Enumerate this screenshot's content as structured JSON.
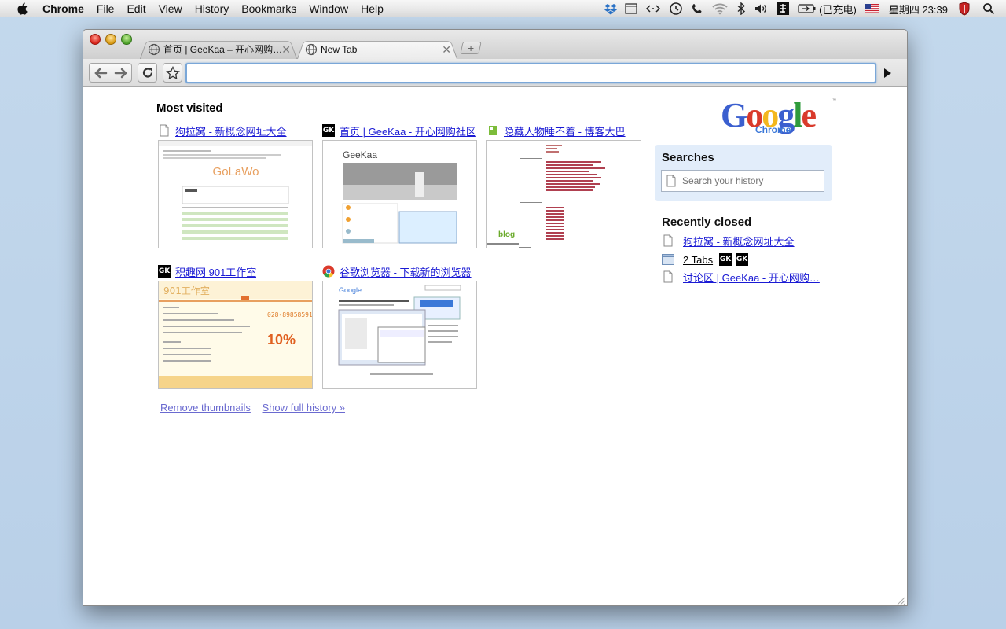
{
  "menubar": {
    "app_name": "Chrome",
    "items": [
      "File",
      "Edit",
      "View",
      "History",
      "Bookmarks",
      "Window",
      "Help"
    ],
    "battery_status": "(已充电)",
    "clock": "星期四 23:39"
  },
  "tabs": [
    {
      "title": "首页 | GeeKaa – 开心网购社区",
      "icon": "globe-icon",
      "active": false
    },
    {
      "title": "New Tab",
      "icon": "globe-icon",
      "active": true
    }
  ],
  "omnibox": {
    "value": ""
  },
  "most_visited": {
    "heading": "Most visited",
    "tiles": [
      {
        "title": "狗拉窝 - 新概念网址大全",
        "icon": "page-icon",
        "thumb_text": "GoLaWo"
      },
      {
        "title": "首页 | GeeKaa - 开心网购社区",
        "icon": "gk-icon",
        "thumb_text": "GeeKaa"
      },
      {
        "title": "隐藏人物睡不着 - 博客大巴",
        "icon": "blogbus-icon",
        "thumb_text": "blog"
      },
      {
        "title": "积趣网 901工作室",
        "icon": "gk-icon",
        "thumb_text": "901工作室",
        "thumb_phone": "028-89858591",
        "thumb_big": "10%"
      },
      {
        "title": "谷歌浏览器 - 下载新的浏览器",
        "icon": "chrome-icon",
        "thumb_text": "Google"
      }
    ],
    "remove_thumbnails": "Remove thumbnails",
    "show_full_history": "Show full history »"
  },
  "logo": {
    "word": "Google",
    "sub": "Chrome"
  },
  "searches": {
    "heading": "Searches",
    "placeholder": "Search your history"
  },
  "recently_closed": {
    "heading": "Recently closed",
    "items": [
      {
        "type": "page",
        "title": "狗拉窝 - 新概念网址大全"
      },
      {
        "type": "window",
        "title": "2 Tabs",
        "gk_badges": [
          "GK",
          "GK"
        ]
      },
      {
        "type": "page",
        "title": "讨论区 | GeeKaa - 开心网购…"
      }
    ]
  },
  "colors": {
    "link": "#1a1ad4",
    "visited_link": "#6a6ad0",
    "searches_bg": "#e2edfa",
    "omnibox_focus": "#7aa7d8"
  }
}
